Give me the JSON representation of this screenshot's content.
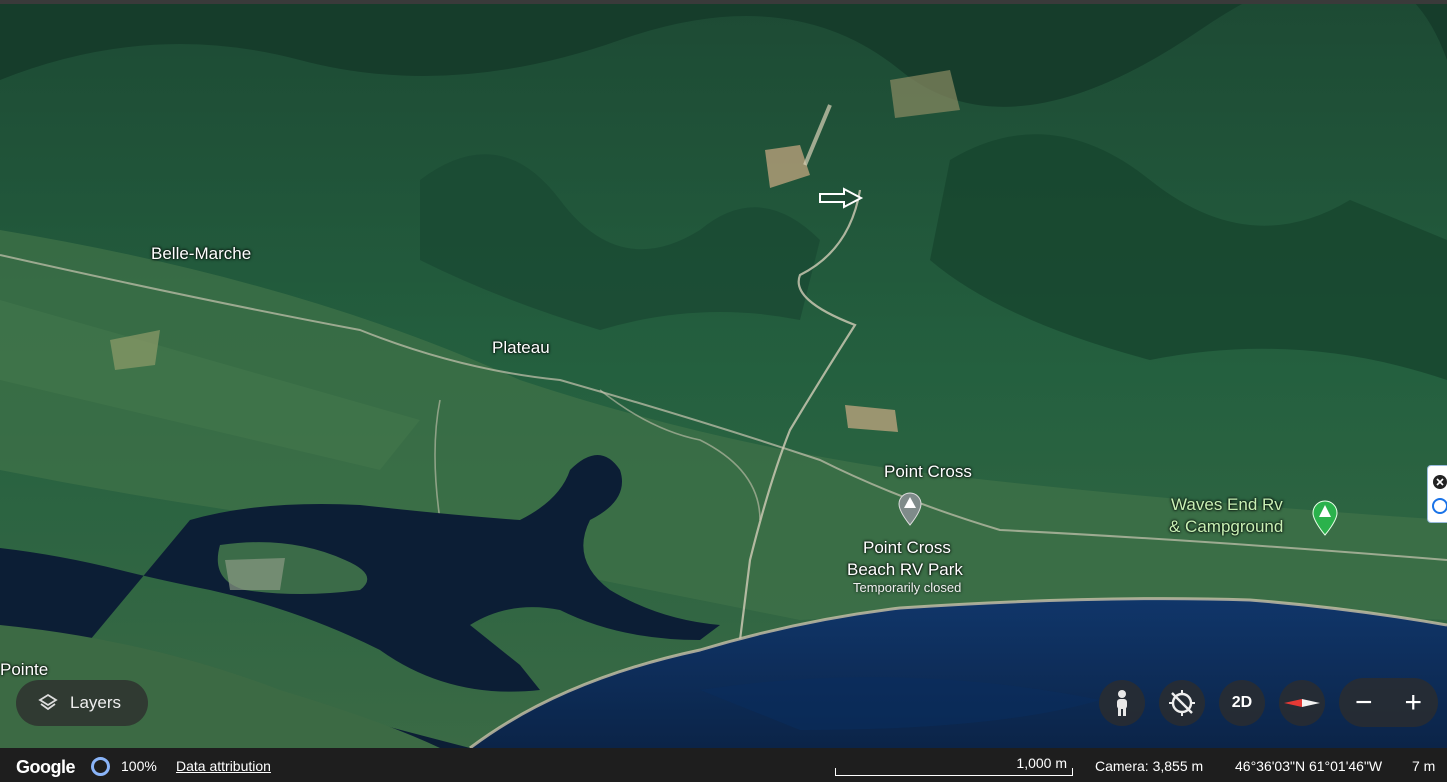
{
  "places": {
    "belle_marche": "Belle-Marche",
    "plateau": "Plateau",
    "point_cross": "Point Cross",
    "point_cross_beach_line1": "Point Cross",
    "point_cross_beach_line2": "Beach RV Park",
    "point_cross_beach_status": "Temporarily closed",
    "waves_end_line1": "Waves End Rv",
    "waves_end_line2": "& Campground",
    "pointe": "Pointe"
  },
  "controls": {
    "layers_label": "Layers",
    "icon_pegman": "pegman-icon",
    "icon_tilt": "tilt-icon",
    "view_2d_label": "2D",
    "icon_compass": "compass-icon",
    "zoom_out_label": "−",
    "zoom_in_label": "+"
  },
  "status_bar": {
    "logo": "Google",
    "loading_pct": "100%",
    "data_attribution": "Data attribution",
    "scale_label": "1,000 m",
    "camera": "Camera: 3,855 m",
    "coordinates": "46°36'03\"N 61°01'46\"W",
    "elevation": "7 m"
  },
  "colors": {
    "forest": "#1f5a3a",
    "water": "#0c1e35",
    "sea": "#0f2d5a",
    "campground_pin": "#2bb24c",
    "poi_pin": "#7a8a8a"
  }
}
